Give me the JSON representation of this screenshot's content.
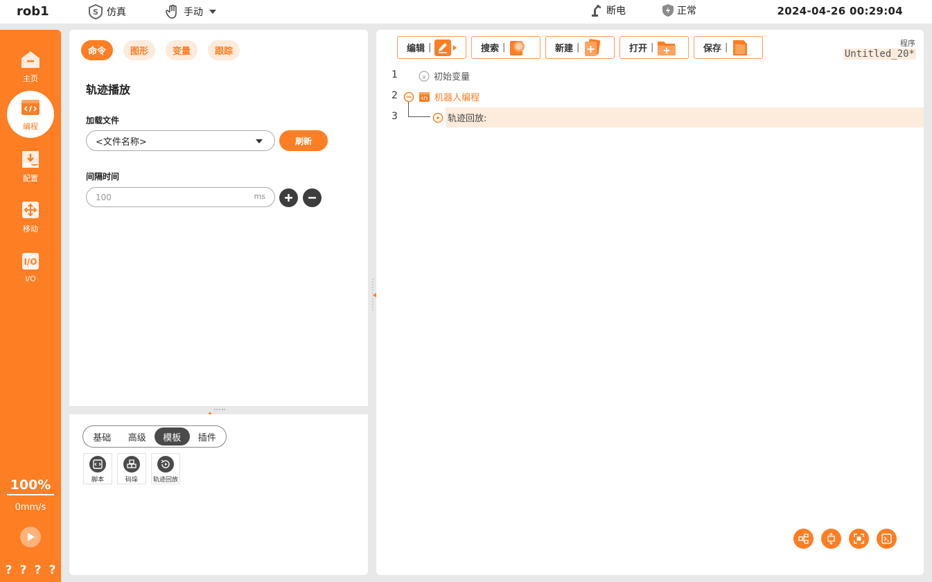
{
  "topbar": {
    "robot_name": "rob1",
    "mode_sim": "仿真",
    "mode_manual": "手动",
    "power": "断电",
    "status": "正常",
    "datetime": "2024-04-26 00:29:04"
  },
  "sidebar": {
    "items": [
      {
        "label": "主页",
        "icon": "home-icon"
      },
      {
        "label": "编程",
        "icon": "code-icon"
      },
      {
        "label": "配置",
        "icon": "config-icon"
      },
      {
        "label": "移动",
        "icon": "move-icon"
      },
      {
        "label": "I/O",
        "icon": "io-icon"
      }
    ],
    "speed_percent": "100%",
    "speed_value": "0mm/s",
    "question_marks": [
      "?",
      "?",
      "?",
      "?"
    ]
  },
  "command_panel": {
    "tabs": [
      "命令",
      "图形",
      "变量",
      "跟踪"
    ],
    "active_tab": 0,
    "title": "轨迹播放",
    "load_file_label": "加载文件",
    "file_select_value": "<文件名称>",
    "refresh_label": "刷新",
    "interval_label": "间隔时间",
    "interval_placeholder": "100",
    "interval_unit": "ms"
  },
  "palette": {
    "segments": [
      "基础",
      "高级",
      "模板",
      "插件"
    ],
    "active_segment": 2,
    "tiles": [
      {
        "label": "脚本",
        "icon": "script-icon"
      },
      {
        "label": "码垛",
        "icon": "palletize-icon"
      },
      {
        "label": "轨迹回放",
        "icon": "trajectory-replay-icon"
      }
    ]
  },
  "program_panel": {
    "toolbar": [
      {
        "label": "编辑",
        "icon": "edit-icon"
      },
      {
        "label": "搜索",
        "icon": "search-icon"
      },
      {
        "label": "新建",
        "icon": "new-icon"
      },
      {
        "label": "打开",
        "icon": "open-folder-icon"
      },
      {
        "label": "保存",
        "icon": "save-icon"
      }
    ],
    "program_label": "程序",
    "program_name": "Untitled_20*",
    "lines": [
      {
        "no": "1",
        "text": "初始变量"
      },
      {
        "no": "2",
        "text": "机器人编程"
      },
      {
        "no": "3",
        "text": "轨迹回放:"
      }
    ]
  },
  "colors": {
    "accent": "#fd7e23",
    "accent_light": "#fdebdc",
    "dark": "#4a4a4a"
  }
}
